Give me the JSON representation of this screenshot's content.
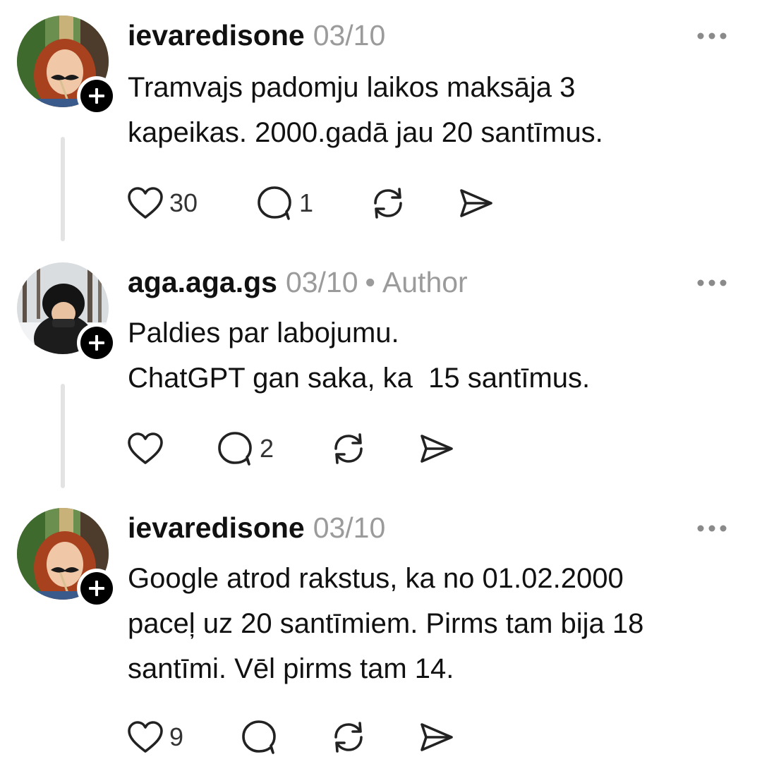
{
  "posts": [
    {
      "username": "ievaredisone",
      "date": "03/10",
      "author_tag": "",
      "body_lines": [
        "Tramvajs padomju laikos maksāja 3",
        "kapeikas. 2000.gadā jau 20 santīmus."
      ],
      "likes": "30",
      "replies": "1",
      "icons": [
        "avatar",
        "follow-plus-icon",
        "more-dots-icon",
        "heart-icon",
        "comment-icon",
        "repost-icon",
        "share-icon"
      ]
    },
    {
      "username": "aga.aga.gs",
      "date": "03/10",
      "separator": "•",
      "author_tag": "Author",
      "body_lines": [
        "Paldies par labojumu.",
        "ChatGPT gan saka, ka  15 santīmus."
      ],
      "likes": "",
      "replies": "2",
      "icons": [
        "avatar",
        "follow-plus-icon",
        "more-dots-icon",
        "heart-icon",
        "comment-icon",
        "repost-icon",
        "share-icon"
      ]
    },
    {
      "username": "ievaredisone",
      "date": "03/10",
      "author_tag": "",
      "body_lines": [
        "Google atrod rakstus, ka no 01.02.2000",
        "paceļ uz 20 santīmiem. Pirms tam bija 18",
        "santīmi. Vēl pirms tam 14."
      ],
      "likes": "9",
      "replies": "",
      "icons": [
        "avatar",
        "follow-plus-icon",
        "more-dots-icon",
        "heart-icon",
        "comment-icon",
        "repost-icon",
        "share-icon"
      ]
    }
  ]
}
